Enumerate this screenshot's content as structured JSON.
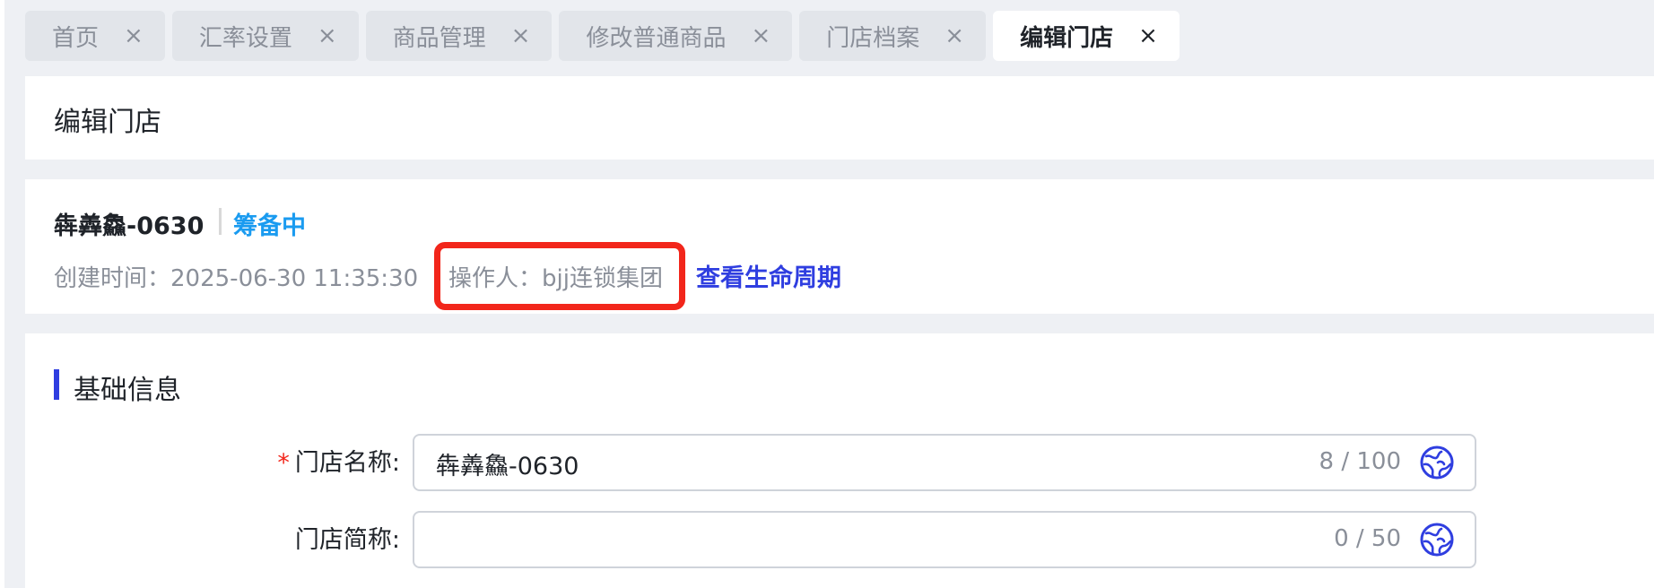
{
  "tabs": [
    {
      "label": "首页",
      "active": false
    },
    {
      "label": "汇率设置",
      "active": false
    },
    {
      "label": "商品管理",
      "active": false
    },
    {
      "label": "修改普通商品",
      "active": false
    },
    {
      "label": "门店档案",
      "active": false
    },
    {
      "label": "编辑门店",
      "active": true
    }
  ],
  "tab_close_glyph": "×",
  "page": {
    "title": "编辑门店"
  },
  "store": {
    "name": "犇羴鱻-0630",
    "status": "筹备中",
    "created_label": "创建时间：",
    "created_value": "2025-06-30 11:35:30",
    "operator_label": "操作人：",
    "operator_value": "bjj连锁集团",
    "lifecycle_link": "查看生命周期"
  },
  "form": {
    "section_title": "基础信息",
    "fields": [
      {
        "label": "门店名称:",
        "required": true,
        "value": "犇羴鱻-0630",
        "counter": "8 / 100",
        "icon": "globe-icon"
      },
      {
        "label": "门店简称:",
        "required": false,
        "value": "",
        "counter": "0 / 50",
        "icon": "globe-icon"
      }
    ]
  },
  "colors": {
    "accent": "#2f3ee0",
    "status": "#1a9bf0",
    "highlight": "#f2261b",
    "required": "#f2261b"
  }
}
